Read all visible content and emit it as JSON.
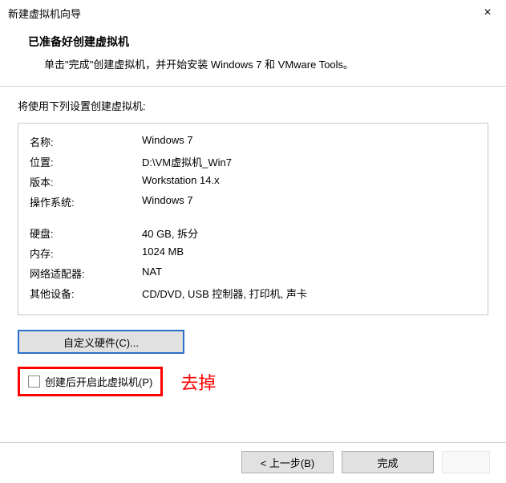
{
  "window": {
    "title": "新建虚拟机向导",
    "close_glyph": "×"
  },
  "header": {
    "title": "已准备好创建虚拟机",
    "description": "单击\"完成\"创建虚拟机，并开始安装 Windows 7 和 VMware Tools。"
  },
  "content": {
    "intro": "将使用下列设置创建虚拟机:"
  },
  "settings": {
    "rows1": [
      {
        "label": "名称:",
        "value": "Windows 7"
      },
      {
        "label": "位置:",
        "value": "D:\\VM虚拟机_Win7"
      },
      {
        "label": "版本:",
        "value": "Workstation 14.x"
      },
      {
        "label": "操作系统:",
        "value": "Windows 7"
      }
    ],
    "rows2": [
      {
        "label": "硬盘:",
        "value": "40 GB, 拆分"
      },
      {
        "label": "内存:",
        "value": "1024 MB"
      },
      {
        "label": "网络适配器:",
        "value": "NAT"
      },
      {
        "label": "其他设备:",
        "value": "CD/DVD, USB 控制器, 打印机, 声卡"
      }
    ]
  },
  "buttons": {
    "customize": "自定义硬件(C)...",
    "back": "< 上一步(B)",
    "finish": "完成",
    "cancel": ""
  },
  "checkbox": {
    "label": "创建后开启此虚拟机(P)"
  },
  "annotation": {
    "text": "去掉",
    "color": "#ff0000"
  }
}
